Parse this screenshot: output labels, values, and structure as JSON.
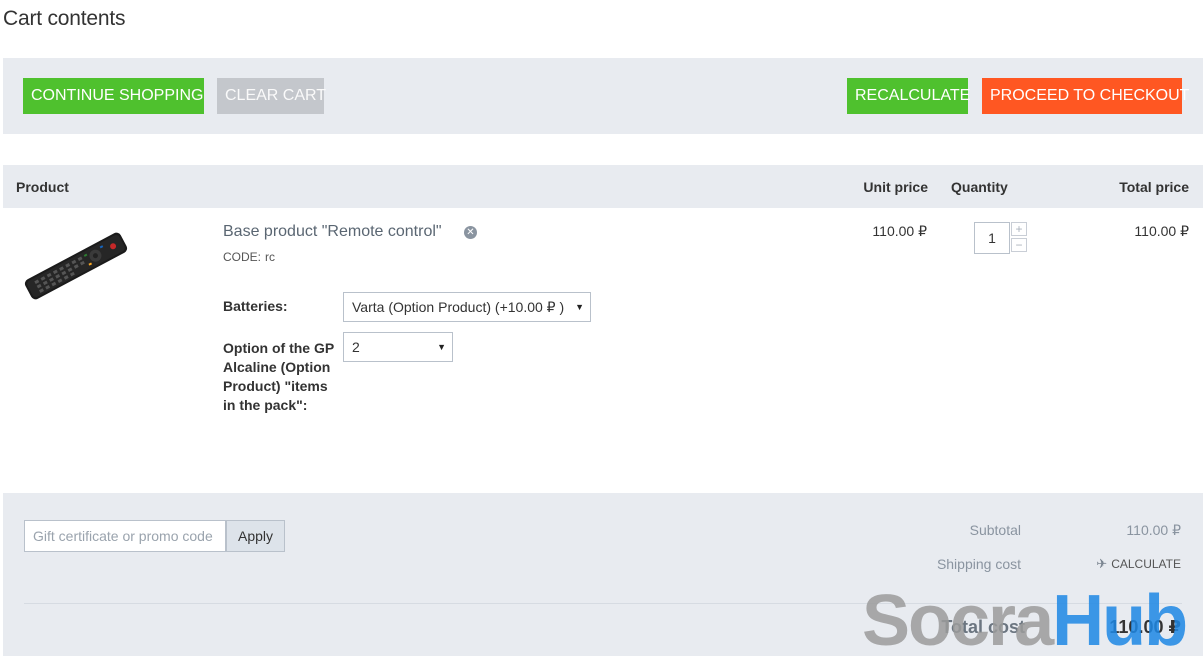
{
  "page": {
    "title": "Cart contents"
  },
  "toolbar": {
    "continue_label": "CONTINUE SHOPPING",
    "clear_label": "CLEAR CART",
    "recalculate_label": "RECALCULATE",
    "checkout_label": "PROCEED TO CHECKOUT"
  },
  "table": {
    "headers": {
      "product": "Product",
      "unit_price": "Unit price",
      "quantity": "Quantity",
      "total_price": "Total price"
    }
  },
  "item": {
    "name": "Base product \"Remote control\"",
    "code_label": "CODE:",
    "code": "rc",
    "unit_price": "110.00 ₽",
    "quantity": "1",
    "total_price": "110.00 ₽",
    "options": [
      {
        "label": "Batteries:",
        "selected": "Varta (Option Product) (+10.00 ₽ )"
      },
      {
        "label": "Option of the GP Alcaline (Option Product) \"items in the pack\":",
        "selected": "2"
      }
    ]
  },
  "summary": {
    "promo_placeholder": "Gift certificate or promo code",
    "apply_label": "Apply",
    "subtotal_label": "Subtotal",
    "subtotal_value": "110.00 ₽",
    "shipping_label": "Shipping cost",
    "calculate_label": "CALCULATE",
    "total_label": "Total cost",
    "total_value": "110.00 ₽"
  },
  "watermark": {
    "part1": "Socra",
    "part2": "Hub"
  },
  "icons": {
    "remove": "remove-circle-icon",
    "plane": "plane-icon",
    "caret": "caret-down-icon"
  },
  "colors": {
    "green": "#4fc12e",
    "orange": "#ff5722",
    "gray_button": "#c4c7cc",
    "panel_bg": "#e8ebf0"
  }
}
